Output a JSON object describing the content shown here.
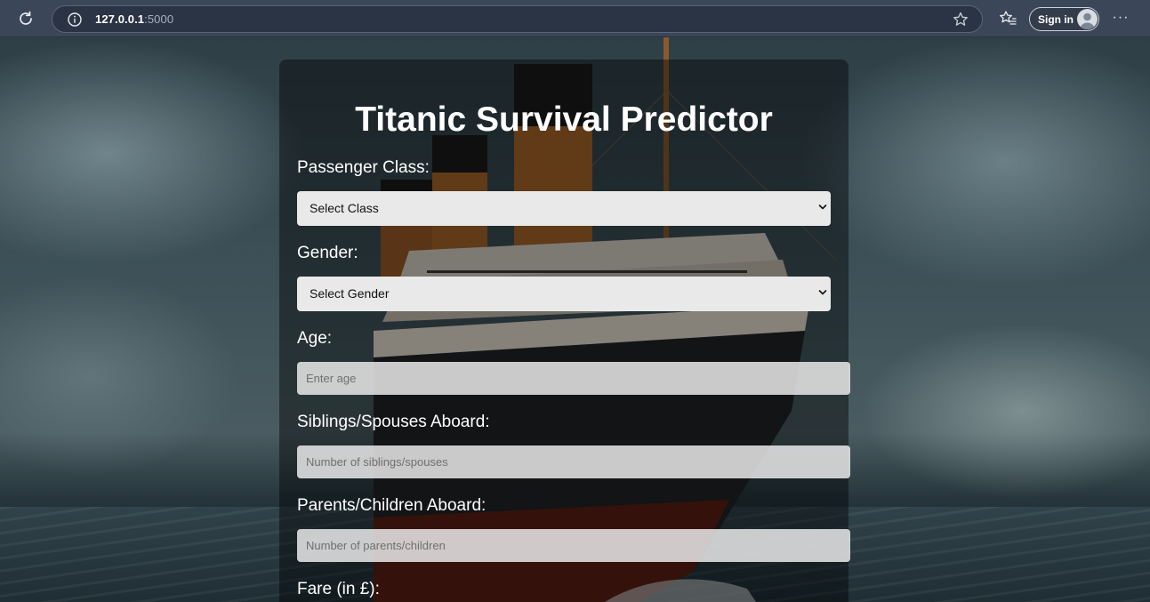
{
  "browser": {
    "url_host": "127.0.0.1",
    "url_port": ":5000",
    "signin_label": "Sign in",
    "more_label": "···"
  },
  "page": {
    "title": "Titanic Survival Predictor",
    "fields": {
      "pclass_label": "Passenger Class:",
      "pclass_selected": "Select Class",
      "gender_label": "Gender:",
      "gender_selected": "Select Gender",
      "age_label": "Age:",
      "age_placeholder": "Enter age",
      "sibsp_label": "Siblings/Spouses Aboard:",
      "sibsp_placeholder": "Number of siblings/spouses",
      "parch_label": "Parents/Children Aboard:",
      "parch_placeholder": "Number of parents/children",
      "fare_label": "Fare (in £):"
    }
  },
  "icons": {
    "reload": "reload-icon",
    "info": "info-icon",
    "star": "star-icon",
    "favorites": "favorites-icon",
    "avatar": "avatar-icon",
    "chevron": "chevron-down-icon"
  },
  "colors": {
    "browser_bar": "#3b4658",
    "card_overlay": "rgba(0,0,0,0.42)",
    "field_bg": "#e9e9e9",
    "title_text": "#ffffff"
  }
}
